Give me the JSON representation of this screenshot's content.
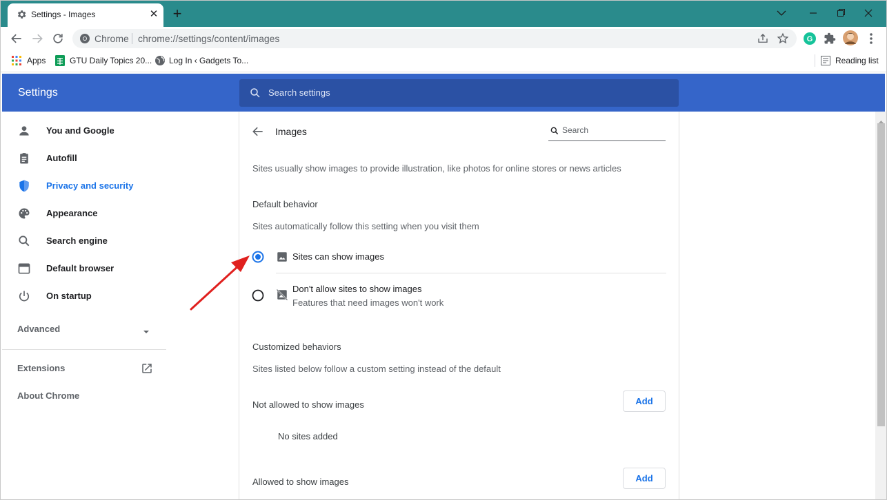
{
  "window": {
    "tab_title": "Settings - Images",
    "close_glyph": "✕",
    "newtab_glyph": "+"
  },
  "toolbar": {
    "omnibox_site": "Chrome",
    "url": "chrome://settings/content/images"
  },
  "bookmarks": {
    "items": [
      {
        "label": "Apps",
        "icon": "apps-grid-icon"
      },
      {
        "label": "GTU Daily Topics 20...",
        "icon": "sheets-icon"
      },
      {
        "label": "Log In ‹ Gadgets To...",
        "icon": "globe-icon"
      }
    ],
    "reading_list": "Reading list"
  },
  "header": {
    "title": "Settings",
    "search_placeholder": "Search settings"
  },
  "sidebar": {
    "items": [
      {
        "label": "You and Google",
        "icon": "person-icon"
      },
      {
        "label": "Autofill",
        "icon": "clipboard-icon"
      },
      {
        "label": "Privacy and security",
        "icon": "shield-icon",
        "active": true
      },
      {
        "label": "Appearance",
        "icon": "palette-icon"
      },
      {
        "label": "Search engine",
        "icon": "search-icon"
      },
      {
        "label": "Default browser",
        "icon": "browser-icon"
      },
      {
        "label": "On startup",
        "icon": "power-icon"
      }
    ],
    "advanced": "Advanced",
    "extensions": "Extensions",
    "about": "About Chrome"
  },
  "page": {
    "title": "Images",
    "search_placeholder": "Search",
    "description": "Sites usually show images to provide illustration, like photos for online stores or news articles",
    "default_heading": "Default behavior",
    "default_sub": "Sites automatically follow this setting when you visit them",
    "options": [
      {
        "label": "Sites can show images",
        "sub": "",
        "selected": true,
        "icon": "image-icon"
      },
      {
        "label": "Don't allow sites to show images",
        "sub": "Features that need images won't work",
        "selected": false,
        "icon": "image-off-icon"
      }
    ],
    "custom_heading": "Customized behaviors",
    "custom_sub": "Sites listed below follow a custom setting instead of the default",
    "not_allowed_label": "Not allowed to show images",
    "no_sites": "No sites added",
    "allowed_label": "Allowed to show images",
    "add_label": "Add"
  },
  "colors": {
    "accent": "#1a73e8",
    "header_bg": "#3565c9",
    "titlebar_bg": "#2a8b8c",
    "annotation_arrow": "#e0201e"
  }
}
